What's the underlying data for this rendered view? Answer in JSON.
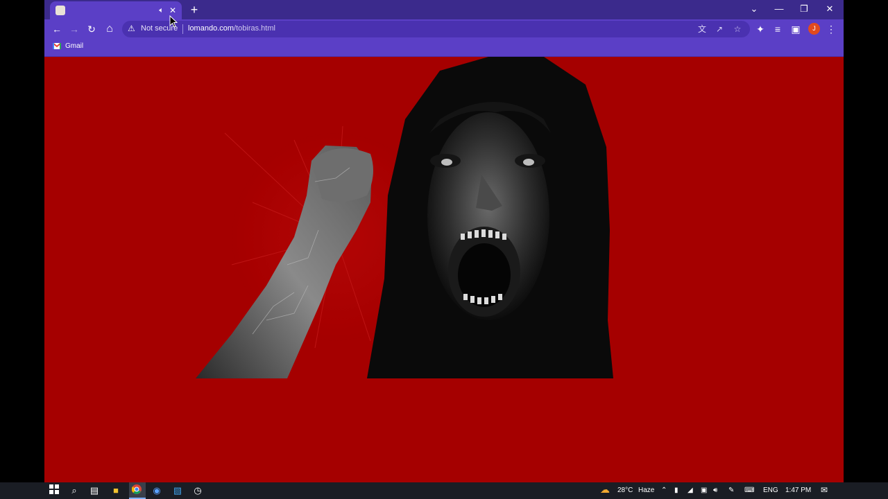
{
  "browser": {
    "tab": {
      "title": "",
      "audio_icon": "speaker-icon",
      "close_glyph": "✕"
    },
    "new_tab_glyph": "+",
    "window_controls": {
      "dropdown_glyph": "⌄",
      "minimize_glyph": "—",
      "restore_glyph": "❐",
      "close_glyph": "✕"
    },
    "toolbar": {
      "back_glyph": "←",
      "forward_glyph": "→",
      "reload_glyph": "↻",
      "home_glyph": "⌂",
      "security_label": "Not secure",
      "url_domain": "lomando.com",
      "url_path": "/tobiras.html",
      "avatar_letter": "J",
      "menu_glyph": "⋮"
    },
    "bookmarks": [
      {
        "label": "Gmail",
        "icon": "gmail-icon"
      }
    ]
  },
  "colors": {
    "page_background": "#a50000",
    "tabstrip": "#3b2a8c",
    "toolbar": "#5b3fc6",
    "omnibox": "#4a31b0",
    "taskbar": "#1a1d24"
  },
  "taskbar": {
    "weather_temp": "28°C",
    "weather_desc": "Haze",
    "language": "ENG",
    "time": "1:47 PM"
  }
}
